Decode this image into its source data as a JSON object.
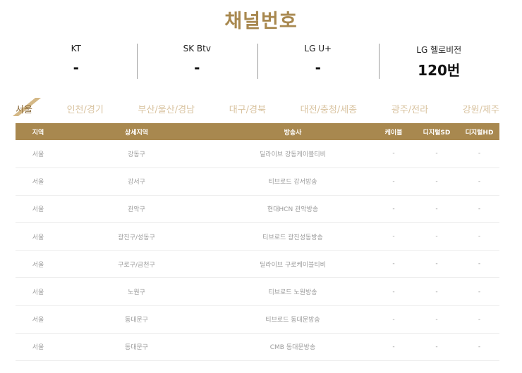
{
  "page": {
    "title": "채널번호"
  },
  "carriers": [
    {
      "name": "KT",
      "value": "-"
    },
    {
      "name": "SK Btv",
      "value": "-"
    },
    {
      "name": "LG U+",
      "value": "-"
    },
    {
      "name": "LG 헬로비전",
      "value": "120번"
    }
  ],
  "tabs": [
    {
      "label": "서울",
      "active": true
    },
    {
      "label": "인천/경기",
      "active": false
    },
    {
      "label": "부산/울산/경남",
      "active": false
    },
    {
      "label": "대구/경북",
      "active": false
    },
    {
      "label": "대전/충청/세종",
      "active": false
    },
    {
      "label": "광주/전라",
      "active": false
    },
    {
      "label": "강원/제주",
      "active": false
    }
  ],
  "table": {
    "headers": [
      "지역",
      "상세지역",
      "방송사",
      "케이블",
      "디지털SD",
      "디지털HD"
    ],
    "rows": [
      [
        "서울",
        "강동구",
        "딜라이브 강동케이블티비",
        "-",
        "-",
        "-"
      ],
      [
        "서울",
        "강서구",
        "티브로드 강서방송",
        "-",
        "-",
        "-"
      ],
      [
        "서울",
        "관악구",
        "현대HCN 관악방송",
        "-",
        "-",
        "-"
      ],
      [
        "서울",
        "광진구/성동구",
        "티브로드 광진성동방송",
        "-",
        "-",
        "-"
      ],
      [
        "서울",
        "구로구/금천구",
        "딜라이브 구로케이블티비",
        "-",
        "-",
        "-"
      ],
      [
        "서울",
        "노원구",
        "티브로드 노원방송",
        "-",
        "-",
        "-"
      ],
      [
        "서울",
        "동대문구",
        "티브로드 동대문방송",
        "-",
        "-",
        "-"
      ],
      [
        "서울",
        "동대문구",
        "CMB 동대문방송",
        "-",
        "-",
        "-"
      ]
    ]
  },
  "colors": {
    "accent": "#a8884f",
    "tab_inactive": "#d9c3a0",
    "cell_text": "#9b9b9b"
  }
}
